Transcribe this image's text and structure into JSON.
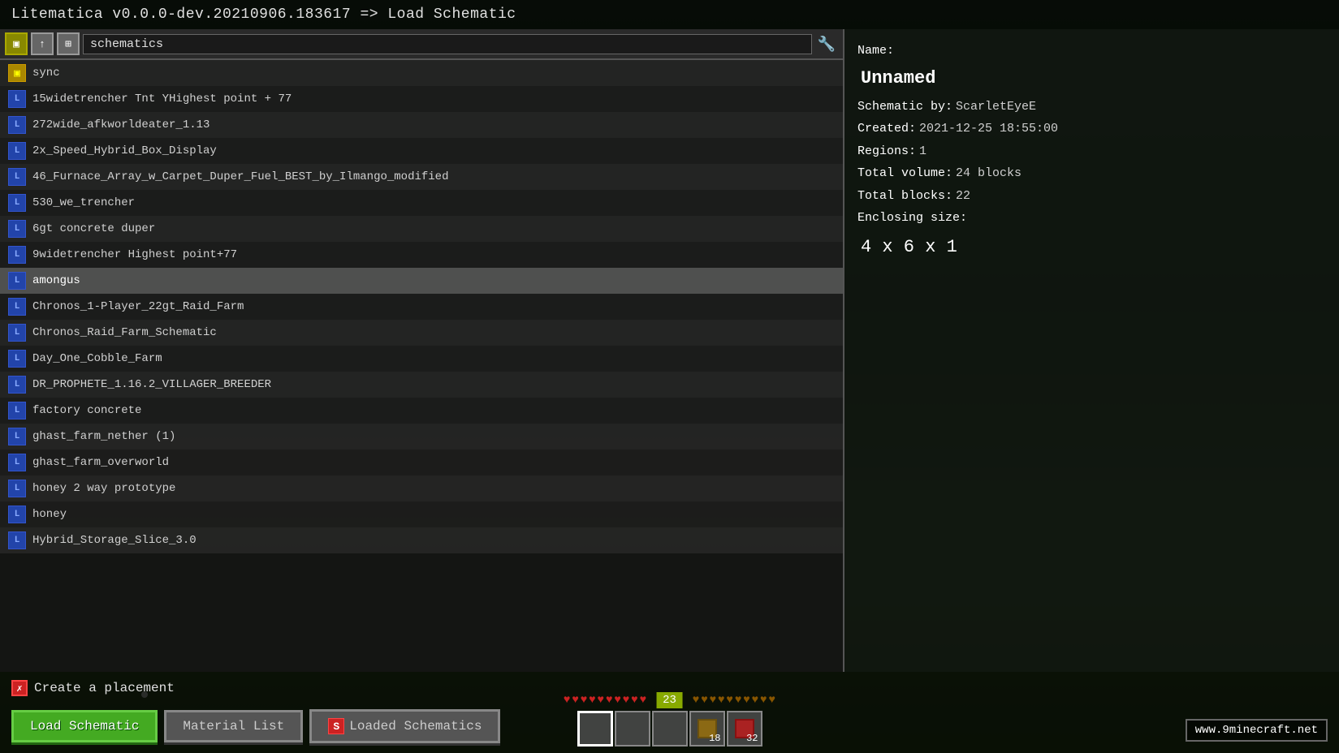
{
  "app": {
    "title": "Litematica v0.0.0-dev.20210906.183617 => Load Schematic"
  },
  "toolbar": {
    "path": "schematics"
  },
  "properties": {
    "name_label": "Name:",
    "name_value": "Unnamed",
    "schematic_by_label": "Schematic by:",
    "schematic_by_value": "ScarletEyeE",
    "created_label": "Created:",
    "created_value": "2021-12-25 18:55:00",
    "regions_label": "Regions:",
    "regions_value": "1",
    "total_volume_label": "Total volume:",
    "total_volume_value": "24 blocks",
    "total_blocks_label": "Total blocks:",
    "total_blocks_value": "22",
    "enclosing_label": "Enclosing size:",
    "enclosing_value": "4 x 6 x 1"
  },
  "files": [
    {
      "name": "sync",
      "type": "folder"
    },
    {
      "name": "15widetrencher Tnt YHighest point + 77",
      "type": "schematic"
    },
    {
      "name": "272wide_afkworldeater_1.13",
      "type": "schematic"
    },
    {
      "name": "2x_Speed_Hybrid_Box_Display",
      "type": "schematic"
    },
    {
      "name": "46_Furnace_Array_w_Carpet_Duper_Fuel_BEST_by_Ilmango_modified",
      "type": "schematic"
    },
    {
      "name": "530_we_trencher",
      "type": "schematic"
    },
    {
      "name": "6gt concrete duper",
      "type": "schematic"
    },
    {
      "name": "9widetrencher Highest point+77",
      "type": "schematic"
    },
    {
      "name": "amongus",
      "type": "schematic",
      "selected": true
    },
    {
      "name": "Chronos_1-Player_22gt_Raid_Farm",
      "type": "schematic"
    },
    {
      "name": "Chronos_Raid_Farm_Schematic",
      "type": "schematic"
    },
    {
      "name": "Day_One_Cobble_Farm",
      "type": "schematic"
    },
    {
      "name": "DR_PROPHETE_1.16.2_VILLAGER_BREEDER",
      "type": "schematic"
    },
    {
      "name": "factory concrete",
      "type": "schematic"
    },
    {
      "name": "ghast_farm_nether (1)",
      "type": "schematic"
    },
    {
      "name": "ghast_farm_overworld",
      "type": "schematic"
    },
    {
      "name": "honey 2 way prototype",
      "type": "schematic"
    },
    {
      "name": "honey",
      "type": "schematic"
    },
    {
      "name": "Hybrid_Storage_Slice_3.0",
      "type": "schematic"
    }
  ],
  "bottom": {
    "create_placement_label": "Create a placement",
    "load_button": "Load Schematic",
    "material_button": "Material List",
    "loaded_button": "Loaded Schematics",
    "level": "23",
    "watermark": "www.9minecraft.net"
  },
  "hud": {
    "hearts": 10,
    "hunger": 10,
    "hotbar_counts": [
      "",
      "",
      "",
      "18",
      "32"
    ]
  }
}
